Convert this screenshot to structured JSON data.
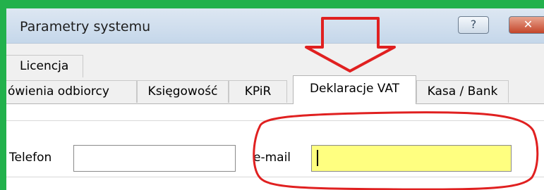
{
  "window": {
    "title": "Parametry systemu"
  },
  "titlebar_buttons": {
    "help": "?",
    "close": "✕"
  },
  "tabs_row1": [
    {
      "label": "Licencja"
    }
  ],
  "tabs_row2": [
    {
      "label": "ówienia odbiorcy"
    },
    {
      "label": "Księgowość"
    },
    {
      "label": "KPiR"
    },
    {
      "label": "Deklaracje VAT",
      "selected": true
    },
    {
      "label": "Kasa / Bank"
    }
  ],
  "form": {
    "telefon": {
      "label": "Telefon",
      "value": ""
    },
    "email": {
      "label": "e-mail",
      "value": "",
      "highlight_color": "#ffff80"
    }
  },
  "annotation_colors": {
    "arrow": "#e02020",
    "ellipse": "#e02020",
    "frame": "#22b14c"
  },
  "icons": {
    "help": "question-mark-icon",
    "close": "close-icon",
    "arrow": "down-arrow-annotation",
    "ellipse": "highlight-ellipse-annotation"
  }
}
